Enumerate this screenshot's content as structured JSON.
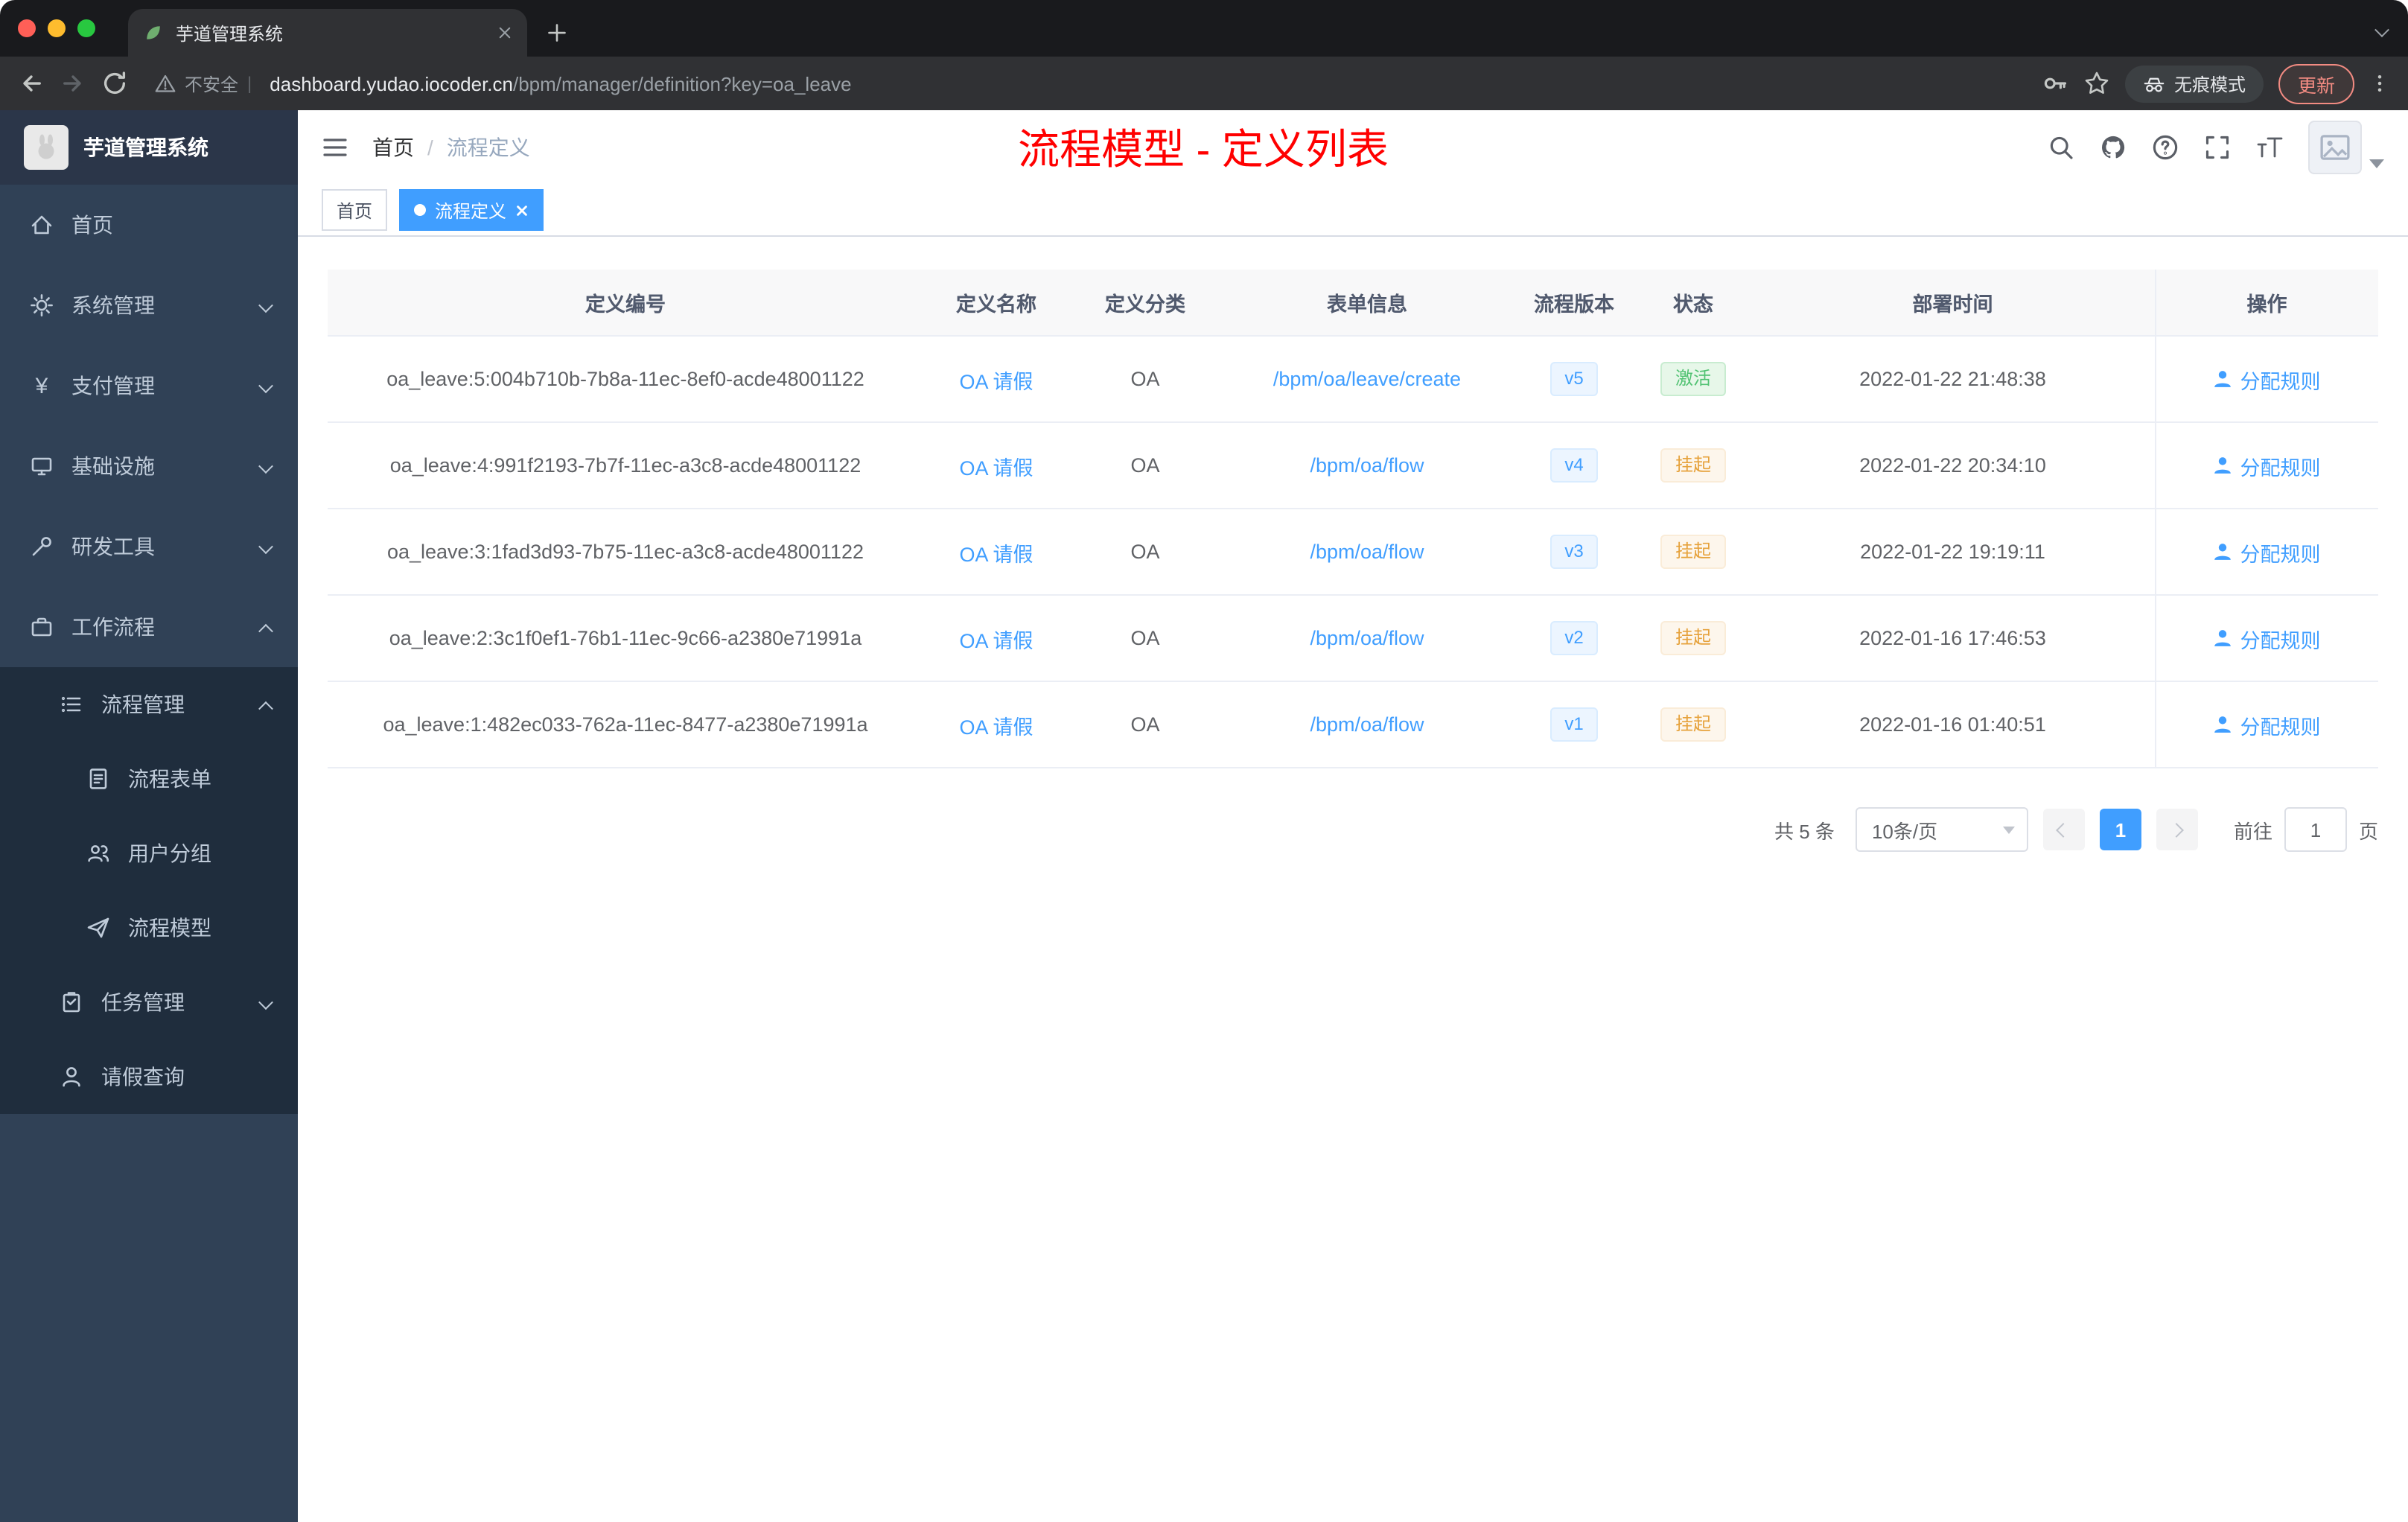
{
  "browser": {
    "tab": {
      "title": "芋道管理系统"
    },
    "toolbar": {
      "security_label": "不安全",
      "url_host": "dashboard.yudao.iocoder.cn",
      "url_path": "/bpm/manager/definition?key=oa_leave",
      "incognito_label": "无痕模式",
      "update_label": "更新"
    }
  },
  "sidebar": {
    "title": "芋道管理系统",
    "items": [
      {
        "label": "首页"
      },
      {
        "label": "系统管理"
      },
      {
        "label": "支付管理"
      },
      {
        "label": "基础设施"
      },
      {
        "label": "研发工具"
      },
      {
        "label": "工作流程"
      },
      {
        "label": "流程管理"
      },
      {
        "label": "流程表单"
      },
      {
        "label": "用户分组"
      },
      {
        "label": "流程模型"
      },
      {
        "label": "任务管理"
      },
      {
        "label": "请假查询"
      }
    ],
    "yen_glyph": "¥"
  },
  "header": {
    "breadcrumb_home": "首页",
    "breadcrumb_sep": "/",
    "breadcrumb_current": "流程定义",
    "page_title": "流程模型 - 定义列表"
  },
  "tags": {
    "home": "首页",
    "current": "流程定义"
  },
  "table": {
    "columns": [
      "定义编号",
      "定义名称",
      "定义分类",
      "表单信息",
      "流程版本",
      "状态",
      "部署时间",
      "操作"
    ],
    "rows": [
      {
        "id": "oa_leave:5:004b710b-7b8a-11ec-8ef0-acde48001122",
        "name": "OA 请假",
        "category": "OA",
        "form": "/bpm/oa/leave/create",
        "version": "v5",
        "status": "激活",
        "status_type": "success",
        "time": "2022-01-22 21:48:38",
        "action": "分配规则"
      },
      {
        "id": "oa_leave:4:991f2193-7b7f-11ec-a3c8-acde48001122",
        "name": "OA 请假",
        "category": "OA",
        "form": "/bpm/oa/flow",
        "version": "v4",
        "status": "挂起",
        "status_type": "warning",
        "time": "2022-01-22 20:34:10",
        "action": "分配规则"
      },
      {
        "id": "oa_leave:3:1fad3d93-7b75-11ec-a3c8-acde48001122",
        "name": "OA 请假",
        "category": "OA",
        "form": "/bpm/oa/flow",
        "version": "v3",
        "status": "挂起",
        "status_type": "warning",
        "time": "2022-01-22 19:19:11",
        "action": "分配规则"
      },
      {
        "id": "oa_leave:2:3c1f0ef1-76b1-11ec-9c66-a2380e71991a",
        "name": "OA 请假",
        "category": "OA",
        "form": "/bpm/oa/flow",
        "version": "v2",
        "status": "挂起",
        "status_type": "warning",
        "time": "2022-01-16 17:46:53",
        "action": "分配规则"
      },
      {
        "id": "oa_leave:1:482ec033-762a-11ec-8477-a2380e71991a",
        "name": "OA 请假",
        "category": "OA",
        "form": "/bpm/oa/flow",
        "version": "v1",
        "status": "挂起",
        "status_type": "warning",
        "time": "2022-01-16 01:40:51",
        "action": "分配规则"
      }
    ]
  },
  "pagination": {
    "total": "共 5 条",
    "page_size": "10条/页",
    "current_page": "1",
    "goto_label": "前往",
    "goto_value": "1",
    "goto_suffix": "页"
  },
  "colors": {
    "primary": "#409eff",
    "success": "#67c23a",
    "warning": "#e6a23c",
    "title_red": "#ff0000",
    "sidebar_bg": "#304156",
    "submenu_bg": "#1f2d3d"
  }
}
